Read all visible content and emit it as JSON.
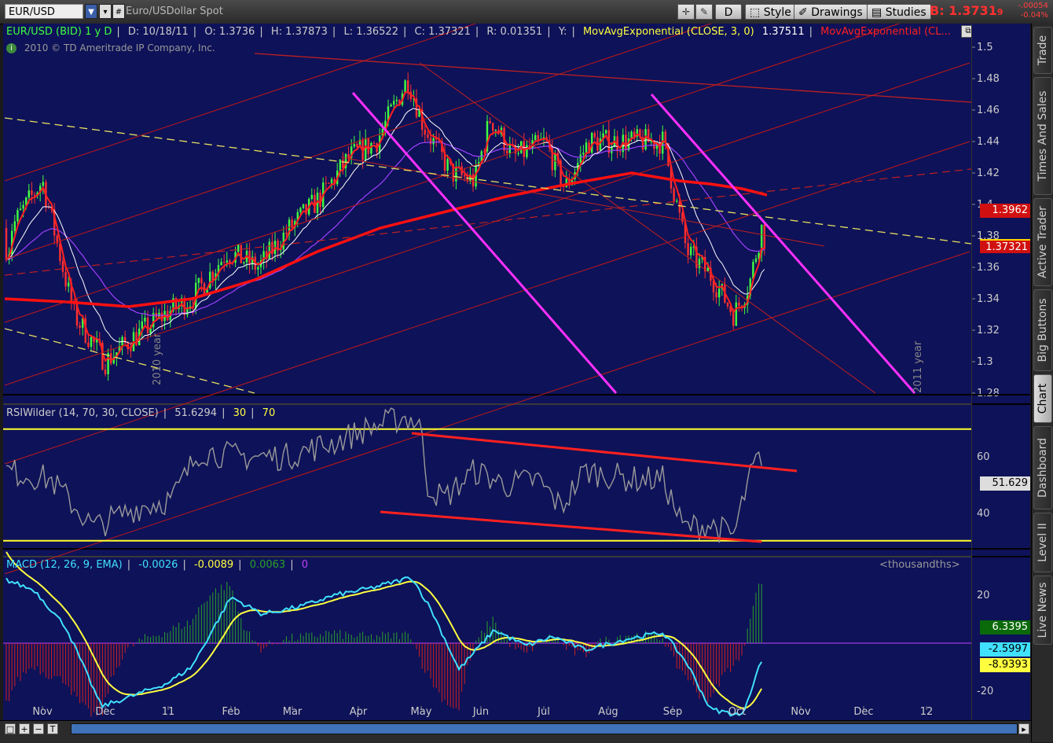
{
  "toolbar": {
    "symbol": "EUR/USD",
    "description": "Euro/USDollar Spot",
    "timeframe_btn": "D",
    "style_label": "Style",
    "drawings_label": "Drawings",
    "studies_label": "Studies",
    "bid_label": "B:",
    "bid_value": "1.3731",
    "bid_small": "9",
    "change_abs": "-.00054",
    "change_pct": "-0.04%"
  },
  "price_panel": {
    "header": {
      "symbol": "EUR/USD (BID) 1 y D",
      "date": "D: 10/18/11",
      "open": "O: 1.3736",
      "high": "H: 1.37873",
      "low": "L: 1.36522",
      "close": "C: 1.37321",
      "range": "R: 0.01351",
      "y": "Y:",
      "ema1": "MovAvgExponential (CLOSE, 3, 0)",
      "ema1_val": "1.37511",
      "ema2": "MovAvgExponential (CL..."
    },
    "copyright": "2010 © TD Ameritrade IP Company, Inc.",
    "year_2010": "2010 year",
    "year_2011": "2011 year",
    "price_ticks": [
      "1.5",
      "1.48",
      "1.46",
      "1.44",
      "1.42",
      "1.4",
      "1.38",
      "1.36",
      "1.34",
      "1.32",
      "1.3",
      "1.28"
    ],
    "tag_upper": "1.3962",
    "tag_last": "1.37321"
  },
  "rsi_panel": {
    "header": "RSIWilder (14, 70, 30, CLOSE)",
    "value": "51.6294",
    "ob": "30",
    "os": "70",
    "ticks": [
      "60",
      "40"
    ],
    "tag": "51.629"
  },
  "macd_panel": {
    "header": "MACD (12, 26, 9, EMA)",
    "v1": "-0.0026",
    "v2": "-0.0089",
    "v3": "0.0063",
    "v4": "0",
    "units": "<thousandths>",
    "ticks": [
      "20",
      "-20"
    ],
    "tag_hist": "6.3395",
    "tag_macd": "-2.5997",
    "tag_signal": "-8.9393"
  },
  "x_axis": [
    "Nov",
    "Dec",
    "11",
    "Feb",
    "Mar",
    "Apr",
    "May",
    "Jun",
    "Jul",
    "Aug",
    "Sep",
    "Oct",
    "Nov",
    "Dec",
    "12"
  ],
  "sidebar": [
    "Trade",
    "Times And Sales",
    "Active Trader",
    "Big Buttons",
    "Chart",
    "Dashboard",
    "Level II",
    "Live News"
  ],
  "colors": {
    "background": "#0e1258",
    "bull": "#40ff40",
    "bear": "#ff3030",
    "ema_fast": "#ff2020",
    "ema_white": "#ffffff",
    "ema_purple": "#a040ff",
    "channel": "#c01818",
    "trend_magenta": "#ff30ff",
    "dashed_yellow": "#e8e060"
  },
  "chart_data": {
    "type": "line",
    "title": "EUR/USD (BID) 1 y D",
    "x": [
      "Nov",
      "Dec",
      "11",
      "Feb",
      "Mar",
      "Apr",
      "May",
      "Jun",
      "Jul",
      "Aug",
      "Sep",
      "Oct"
    ],
    "series": [
      {
        "name": "EUR/USD",
        "values": [
          1.395,
          1.3,
          1.325,
          1.36,
          1.39,
          1.435,
          1.465,
          1.44,
          1.425,
          1.43,
          1.37,
          1.35
        ]
      },
      {
        "name": "RSIWilder (14, 70, 30, CLOSE)",
        "values": [
          55,
          35,
          45,
          60,
          60,
          68,
          55,
          58,
          50,
          52,
          36,
          52
        ]
      },
      {
        "name": "MACD (12, 26, 9, EMA)",
        "values": [
          20,
          -18,
          -10,
          12,
          8,
          10,
          12,
          4,
          0,
          4,
          -15,
          -3
        ]
      }
    ],
    "ylim": [
      1.28,
      1.5
    ],
    "grid": false
  }
}
